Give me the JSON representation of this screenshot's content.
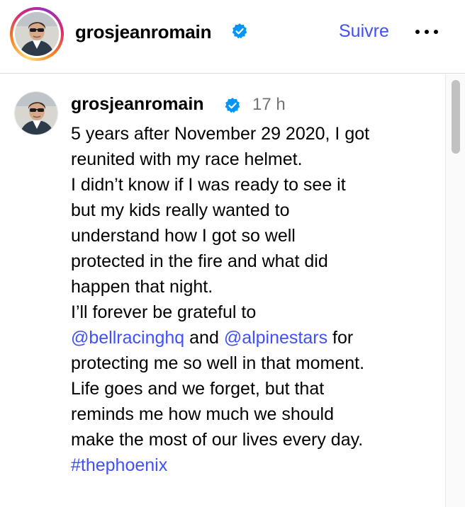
{
  "header": {
    "username": "grosjeanromain",
    "follow_label": "Suivre",
    "more_label": "More options"
  },
  "comment": {
    "username": "grosjeanromain",
    "time": "17 h",
    "lines": [
      "5 years after November 29 2020, I got",
      "reunited with my race helmet.",
      "I didn’t know if I was ready to see it",
      "but my kids really wanted to",
      "understand how I got so well",
      "protected in the fire and what did",
      "happen that night.",
      "I’ll forever be grateful to"
    ],
    "mention1": "@bellracinghq",
    "and_text": " and ",
    "mention2": "@alpinestars",
    "for_text": " for",
    "lines2": [
      "protecting me so well in that moment.",
      "Life goes and we forget, but that",
      "reminds me how much we should",
      "make the most of our lives every day."
    ],
    "hashtag": "#thephoenix"
  },
  "colors": {
    "link": "#4150f7",
    "verified": "#0095f6",
    "muted": "#737373"
  },
  "icons": {
    "verified": "verified-badge-icon",
    "more": "more-horizontal-icon"
  }
}
